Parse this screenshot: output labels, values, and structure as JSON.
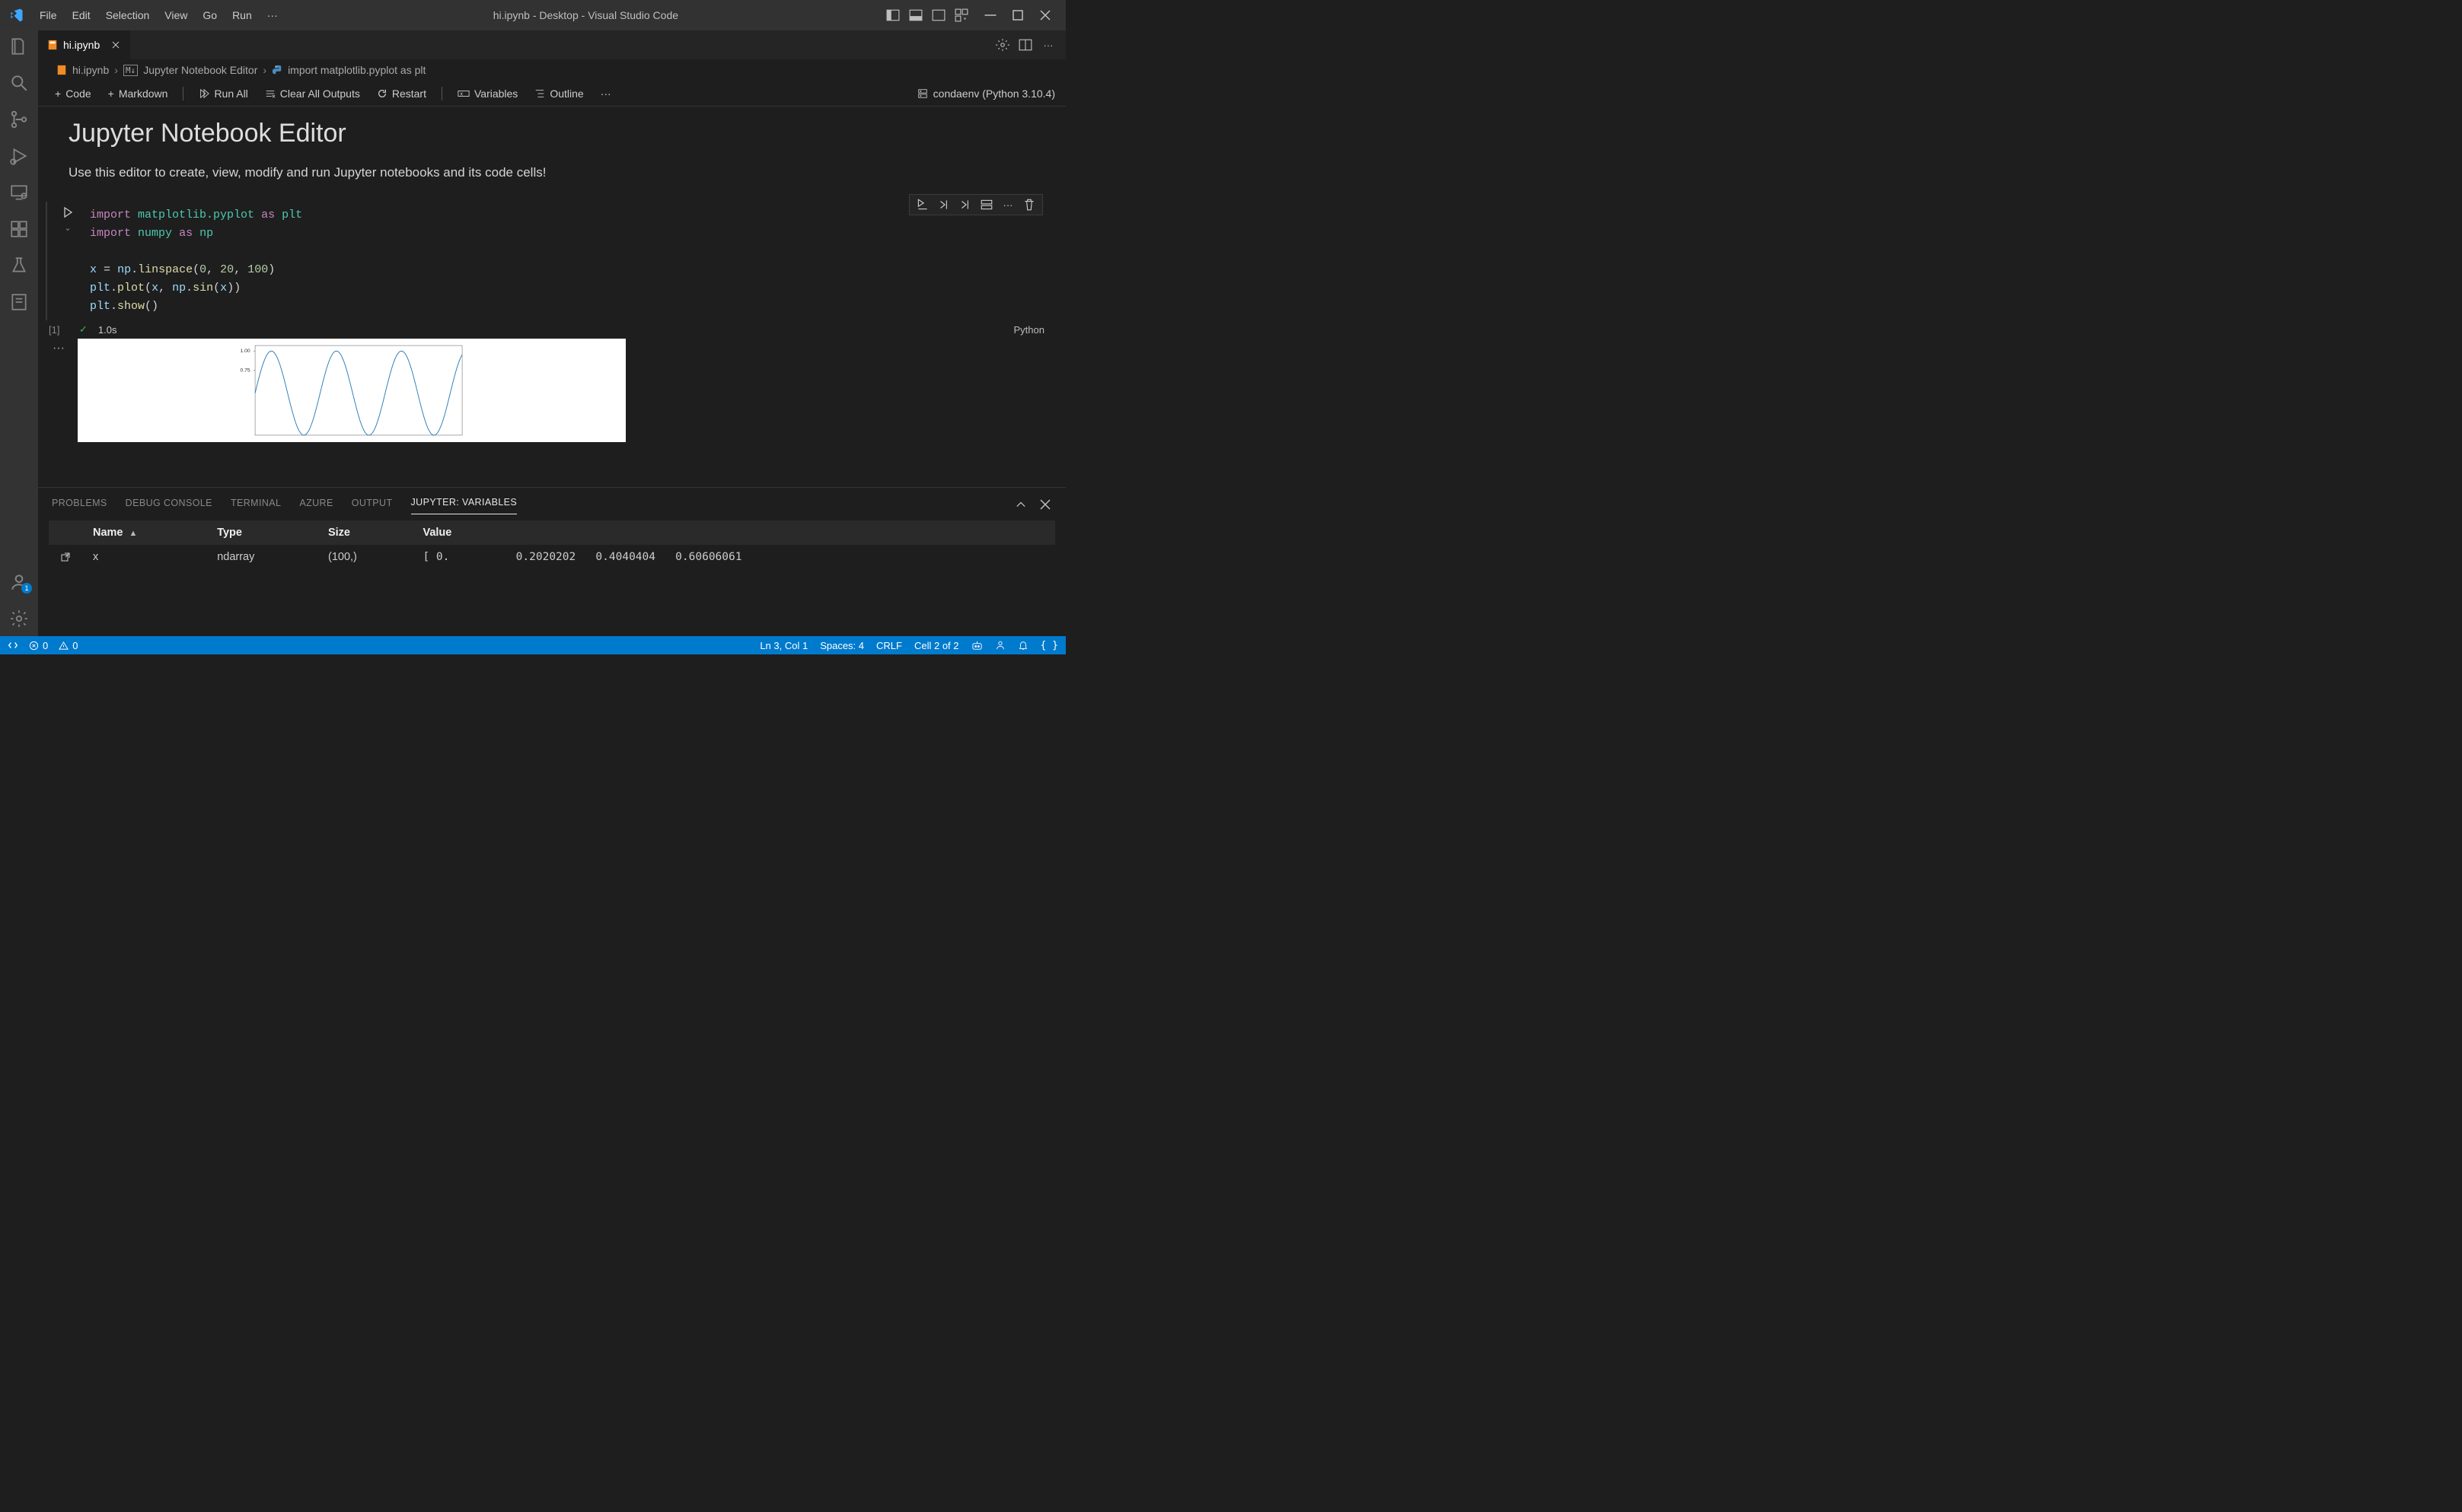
{
  "window": {
    "title": "hi.ipynb - Desktop - Visual Studio Code"
  },
  "menubar": [
    "File",
    "Edit",
    "Selection",
    "View",
    "Go",
    "Run"
  ],
  "tabs": {
    "active": {
      "label": "hi.ipynb"
    }
  },
  "breadcrumb": {
    "file": "hi.ipynb",
    "editor": "Jupyter Notebook Editor",
    "symbol": "import matplotlib.pyplot as plt"
  },
  "notebook_toolbar": {
    "code": "Code",
    "markdown": "Markdown",
    "run_all": "Run All",
    "clear_outputs": "Clear All Outputs",
    "restart": "Restart",
    "variables": "Variables",
    "outline": "Outline",
    "kernel": "condaenv (Python 3.10.4)"
  },
  "notebook": {
    "heading": "Jupyter Notebook Editor",
    "paragraph": "Use this editor to create, view, modify and run Jupyter notebooks and its code cells!",
    "cell": {
      "code_line1": "import matplotlib.pyplot as plt",
      "code_line2": "import numpy as np",
      "code_line3": "x = np.linspace(0, 20, 100)",
      "code_line4": "plt.plot(x, np.sin(x))",
      "code_line5": "plt.show()",
      "exec_index": "[1]",
      "exec_time": "1.0s",
      "language": "Python"
    }
  },
  "chart_data": {
    "type": "line",
    "series_name": "sin(x)",
    "ylim": [
      -1,
      1
    ],
    "visible_yticks": [
      "1.00",
      "0.75"
    ],
    "x_range": [
      0,
      20
    ],
    "color": "#1f77b4",
    "note": "Only the top portion (approx y >= 0.65) of a sine curve over x in [0,20] is visible in the cropped output."
  },
  "panel": {
    "tabs": [
      "PROBLEMS",
      "DEBUG CONSOLE",
      "TERMINAL",
      "AZURE",
      "OUTPUT",
      "JUPYTER: VARIABLES"
    ],
    "active_tab": "JUPYTER: VARIABLES",
    "columns": {
      "name": "Name",
      "type": "Type",
      "size": "Size",
      "value": "Value"
    },
    "row": {
      "name": "x",
      "type": "ndarray",
      "size": "(100,)",
      "value": "[ 0.          0.2020202   0.4040404   0.60606061"
    }
  },
  "statusbar": {
    "errors": "0",
    "warnings": "0",
    "line_col": "Ln 3, Col 1",
    "spaces": "Spaces: 4",
    "eol": "CRLF",
    "cell": "Cell 2 of 2"
  },
  "accounts_badge": "1"
}
